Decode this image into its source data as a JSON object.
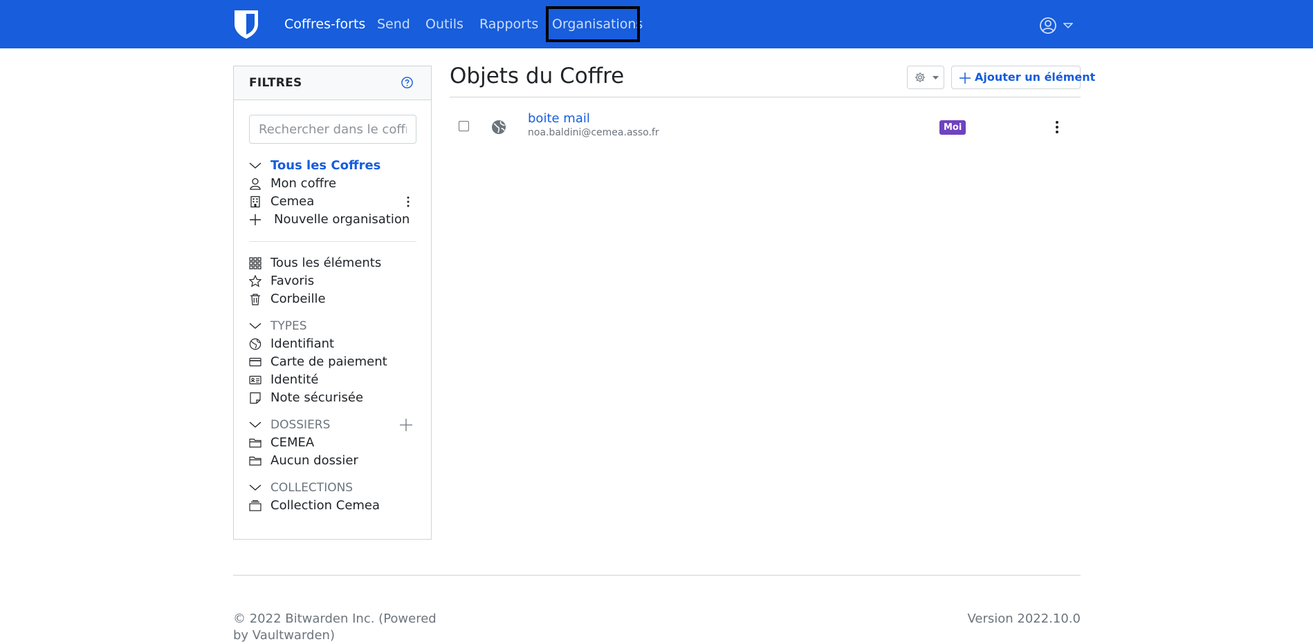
{
  "nav": {
    "items": [
      "Coffres-forts",
      "Send",
      "Outils",
      "Rapports",
      "Organisations"
    ]
  },
  "sidebar": {
    "title": "FILTRES",
    "search_placeholder": "Rechercher dans le coffre",
    "vaults": [
      "Tous les Coffres",
      "Mon coffre",
      "Cemea",
      "Nouvelle organisation"
    ],
    "categories": [
      "Tous les éléments",
      "Favoris",
      "Corbeille"
    ],
    "types_header": "TYPES",
    "types": [
      "Identifiant",
      "Carte de paiement",
      "Identité",
      "Note sécurisée"
    ],
    "folders_header": "DOSSIERS",
    "folders": [
      "CEMEA",
      "Aucun dossier"
    ],
    "collections_header": "COLLECTIONS",
    "collections": [
      "Collection Cemea"
    ]
  },
  "main": {
    "title": "Objets du Coffre",
    "add_label": "Ajouter un élément",
    "items": [
      {
        "name": "boite mail",
        "subtitle": "noa.baldini@cemea.asso.fr",
        "owner_badge": "Moi"
      }
    ]
  },
  "footer": {
    "copyright": "© 2022 Bitwarden Inc. (Powered by Vaultwarden)",
    "version": "Version 2022.10.0"
  },
  "colors": {
    "brand": "#175ddc",
    "badge": "#6f42c1",
    "focus_outline": "#000000"
  }
}
